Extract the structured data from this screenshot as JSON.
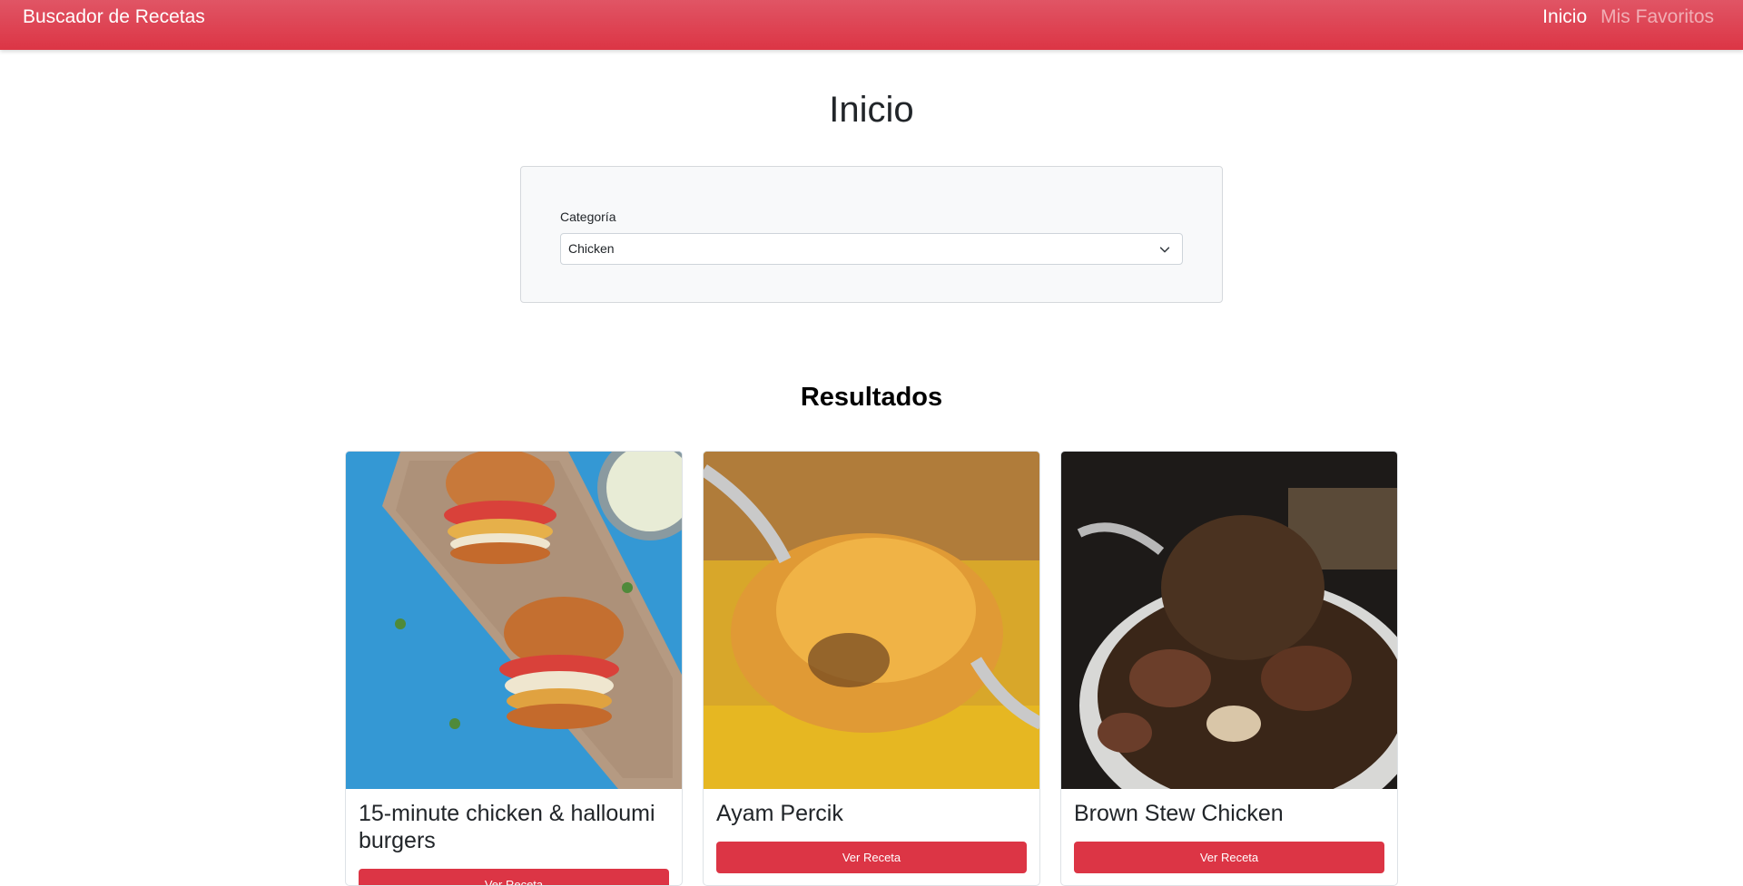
{
  "navbar": {
    "brand": "Buscador de Recetas",
    "links": [
      {
        "label": "Inicio",
        "active": true
      },
      {
        "label": "Mis Favoritos",
        "active": false
      }
    ],
    "color": "#dc3545"
  },
  "page": {
    "title": "Inicio"
  },
  "filter": {
    "label": "Categoría",
    "selected": "Chicken",
    "icon": "chevron-down-icon"
  },
  "results": {
    "title": "Resultados",
    "cards": [
      {
        "title": "15-minute chicken & halloumi burgers",
        "button": "Ver Receta"
      },
      {
        "title": "Ayam Percik",
        "button": "Ver Receta"
      },
      {
        "title": "Brown Stew Chicken",
        "button": "Ver Receta"
      }
    ]
  }
}
